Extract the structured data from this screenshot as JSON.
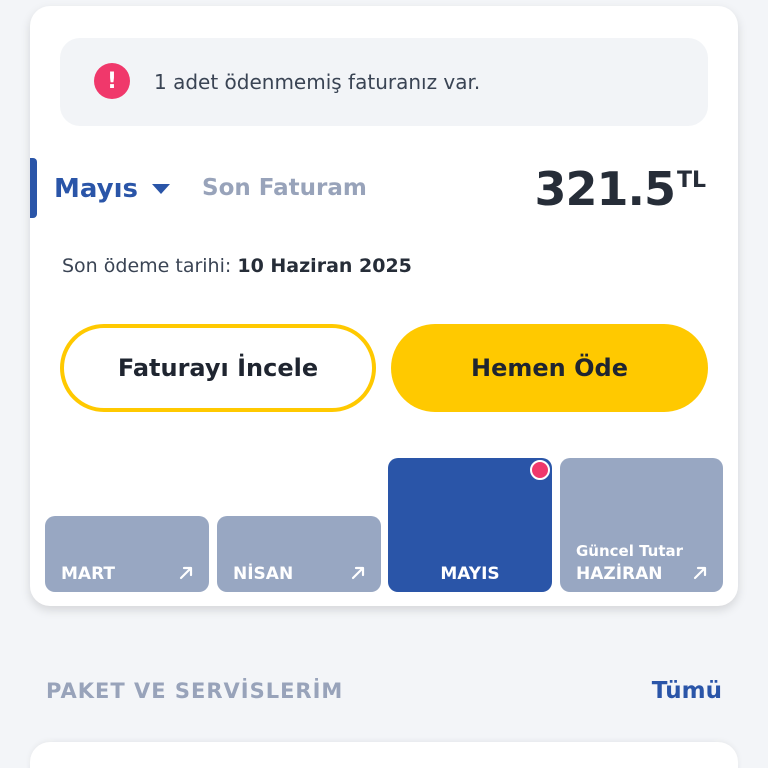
{
  "alert": {
    "icon": "exclamation-circle-icon",
    "icon_glyph": "!",
    "text": "1 adet ödenmemiş faturanız var.",
    "color": "#f0386b"
  },
  "invoice": {
    "selected_month": "Mayıs",
    "title": "Son Faturam",
    "amount": "321.5",
    "currency": "TL",
    "due_label": "Son ödeme tarihi:",
    "due_date": "10 Haziran 2025"
  },
  "actions": {
    "review_label": "Faturayı İncele",
    "pay_label": "Hemen Öde"
  },
  "months": [
    {
      "label": "MART",
      "subtitle": "",
      "active": false,
      "icon": "arrow-up-right-icon"
    },
    {
      "label": "NİSAN",
      "subtitle": "",
      "active": false,
      "icon": "arrow-up-right-icon"
    },
    {
      "label": "MAYIS",
      "subtitle": "",
      "active": true,
      "unpaid": true
    },
    {
      "label": "HAZİRAN",
      "subtitle": "Güncel Tutar",
      "active": false,
      "icon": "arrow-up-right-icon"
    }
  ],
  "services": {
    "title": "PAKET VE SERVİSLERİM",
    "see_all_label": "Tümü"
  },
  "colors": {
    "primary_blue": "#2a55a8",
    "accent_yellow": "#ffc900",
    "alert_pink": "#f0386b",
    "muted_tile": "#98a7c2"
  }
}
